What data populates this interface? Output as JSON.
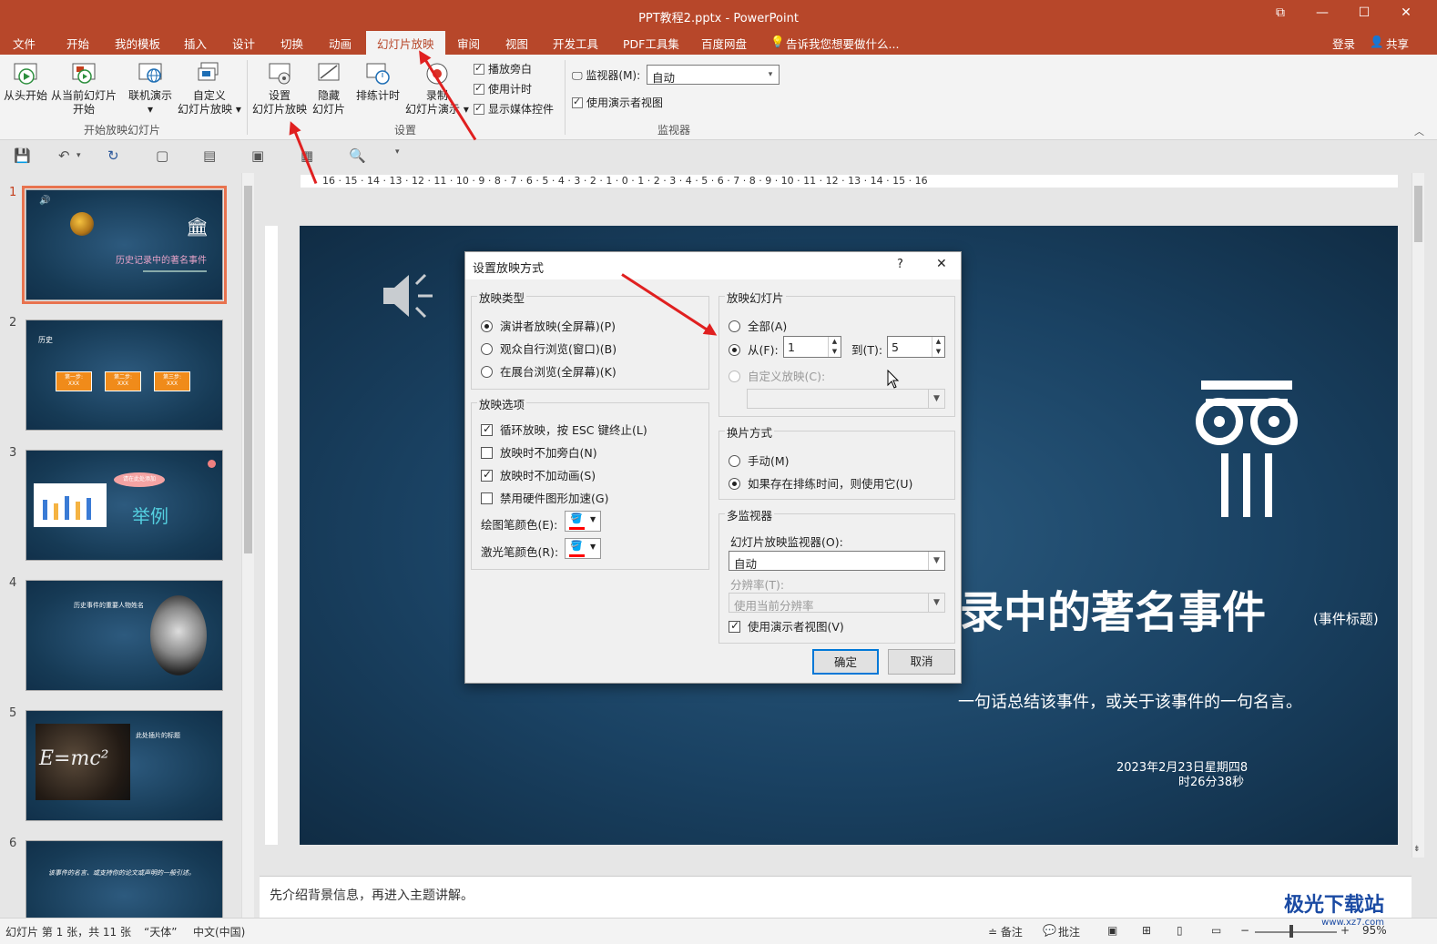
{
  "window": {
    "title": "PPT教程2.pptx - PowerPoint",
    "controls": [
      "⧉",
      "—",
      "☐",
      "✕"
    ]
  },
  "menu": {
    "items": [
      "文件",
      "开始",
      "我的模板",
      "插入",
      "设计",
      "切换",
      "动画",
      "幻灯片放映",
      "审阅",
      "视图",
      "开发工具",
      "PDF工具集",
      "百度网盘"
    ],
    "active": "幻灯片放映",
    "tell_me": "告诉我您想要做什么...",
    "login": "登录",
    "share": "共享"
  },
  "ribbon": {
    "from_start": "从头开始",
    "from_current_1": "从当前幻灯片",
    "from_current_2": "开始",
    "online_1": "联机演示",
    "online_2": "▾",
    "custom_1": "自定义",
    "custom_2": "幻灯片放映 ▾",
    "group_start": "开始放映幻灯片",
    "setup_1": "设置",
    "setup_2": "幻灯片放映",
    "hide_1": "隐藏",
    "hide_2": "幻灯片",
    "rehearse": "排练计时",
    "record_1": "录制",
    "record_2": "幻灯片演示 ▾",
    "play_narration": "播放旁白",
    "use_timings": "使用计时",
    "show_media": "显示媒体控件",
    "group_setup": "设置",
    "monitor_label": "监视器(M):",
    "monitor_value": "自动",
    "presenter_view": "使用演示者视图",
    "group_monitor": "监视器"
  },
  "thumbnails": {
    "numbers": [
      "1",
      "2",
      "3",
      "4",
      "5",
      "6"
    ],
    "t1_title": "历史记录中的著名事件",
    "t2_head": "历史",
    "t2_steps": [
      "第一步:",
      "第二步:",
      "第三步:"
    ],
    "t2_step_sub": "XXX",
    "t3_bubble": "请在此处添加",
    "t3_text": "举例",
    "t4_title": "历史事件的重要人物姓名",
    "t5_eq": "E=mc²",
    "t5_title": "此处插片的标题",
    "t6_text": "该事件的名言、或支持你的论文或声明的一般引述。"
  },
  "slide": {
    "title": "录中的著名事件",
    "tag": "(事件标题)",
    "subtitle": "一句话总结该事件，或关于该事件的一句名言。",
    "date_line1": "2023年2月23日星期四8",
    "date_line2": "时26分38秒"
  },
  "ruler_labels": "16 · 15 · 14 · 13 · 12 · 11 · 10 · 9 · 8 · 7 · 6 · 5 · 4 · 3 · 2 · 1 · 0 · 1 · 2 · 3 · 4 · 5 · 6 · 7 · 8 · 9 · 10 · 11 · 12 · 13 · 14 · 15 · 16",
  "notes": "先介绍背景信息，再进入主题讲解。",
  "status": {
    "slide_info": "幻灯片 第 1 张，共 11 张",
    "theme": "“天体”",
    "lang": "中文(中国)",
    "notes_btn": "≐ 备注",
    "comments_btn": "批注",
    "zoom": "95%"
  },
  "dialog": {
    "title": "设置放映方式",
    "help": "?",
    "close": "✕",
    "show_type": {
      "label": "放映类型",
      "options": [
        "演讲者放映(全屏幕)(P)",
        "观众自行浏览(窗口)(B)",
        "在展台浏览(全屏幕)(K)"
      ],
      "selected": 0
    },
    "show_options": {
      "label": "放映选项",
      "loop": "循环放映，按 ESC 键终止(L)",
      "no_narration": "放映时不加旁白(N)",
      "no_animation": "放映时不加动画(S)",
      "no_hw_accel": "禁用硬件图形加速(G)",
      "pen_color": "绘图笔颜色(E):",
      "laser_color": "激光笔颜色(R):",
      "pen_hex": "#ff0000",
      "laser_hex": "#ff0000"
    },
    "show_slides": {
      "label": "放映幻灯片",
      "all": "全部(A)",
      "from": "从(F):",
      "from_value": "1",
      "to": "到(T):",
      "to_value": "5",
      "custom": "自定义放映(C):"
    },
    "advance": {
      "label": "换片方式",
      "manual": "手动(M)",
      "timings": "如果存在排练时间，则使用它(U)"
    },
    "multi_monitor": {
      "label": "多监视器",
      "monitor_label": "幻灯片放映监视器(O):",
      "monitor_value": "自动",
      "resolution_label": "分辨率(T):",
      "resolution_value": "使用当前分辨率",
      "presenter": "使用演示者视图(V)"
    },
    "ok": "确定",
    "cancel": "取消"
  },
  "watermark": {
    "name": "极光下载站",
    "url": "www.xz7.com"
  }
}
